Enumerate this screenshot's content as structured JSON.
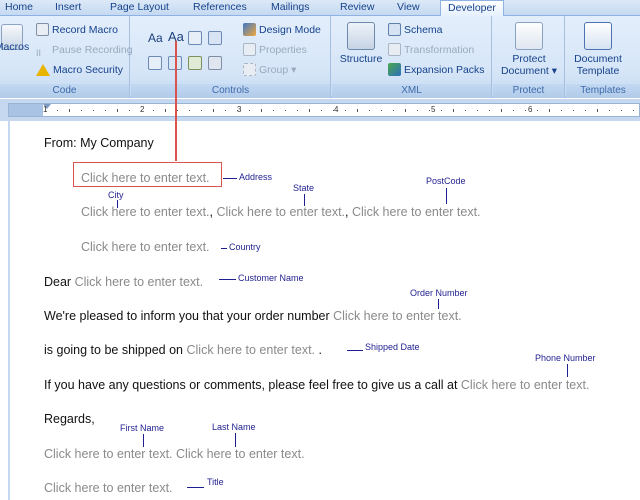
{
  "tabs": [
    "Home",
    "Insert",
    "Page Layout",
    "References",
    "Mailings",
    "Review",
    "View",
    "Developer"
  ],
  "ribbon": {
    "code": {
      "label": "Code",
      "macros": "Macros",
      "record_macro": "Record Macro",
      "pause_recording": "Pause Recording",
      "macro_security": "Macro Security"
    },
    "controls": {
      "label": "Controls",
      "rich_text_aa": "Aa",
      "plain_text_aa": "Aa",
      "design_mode": "Design Mode",
      "properties": "Properties",
      "group": "Group"
    },
    "xml": {
      "label": "XML",
      "structure": "Structure",
      "schema": "Schema",
      "transformation": "Transformation",
      "expansion_packs": "Expansion Packs"
    },
    "protect": {
      "label": "Protect",
      "protect_document": "Protect Document"
    },
    "templates": {
      "label": "Templates",
      "document_template": "Document Template"
    }
  },
  "ruler": {
    "numbers": [
      "1",
      "2",
      "3",
      "4",
      "5",
      "6"
    ]
  },
  "document": {
    "from": "From: My Company",
    "placeholder": "Click here to enter text.",
    "comma": ",",
    "dear": "Dear",
    "order_text": "We're pleased to inform you that your order number",
    "shipped_text": "is going to be shipped on",
    "questions_text": "If you have any questions or comments, please feel free to give us a call at",
    "regards": "Regards,",
    "period": "."
  },
  "annotations": {
    "address": "Address",
    "city": "City",
    "state": "State",
    "postcode": "PostCode",
    "country": "Country",
    "customer_name": "Customer Name",
    "order_number": "Order Number",
    "shipped_date": "Shipped Date",
    "phone_number": "Phone Number",
    "first_name": "First Name",
    "last_name": "Last Name",
    "title": "Title"
  },
  "colors": {
    "accent": "#15428b",
    "placeholder": "#8a8a8a",
    "annotation": "#1f1f8f",
    "highlight": "#d9534f"
  }
}
